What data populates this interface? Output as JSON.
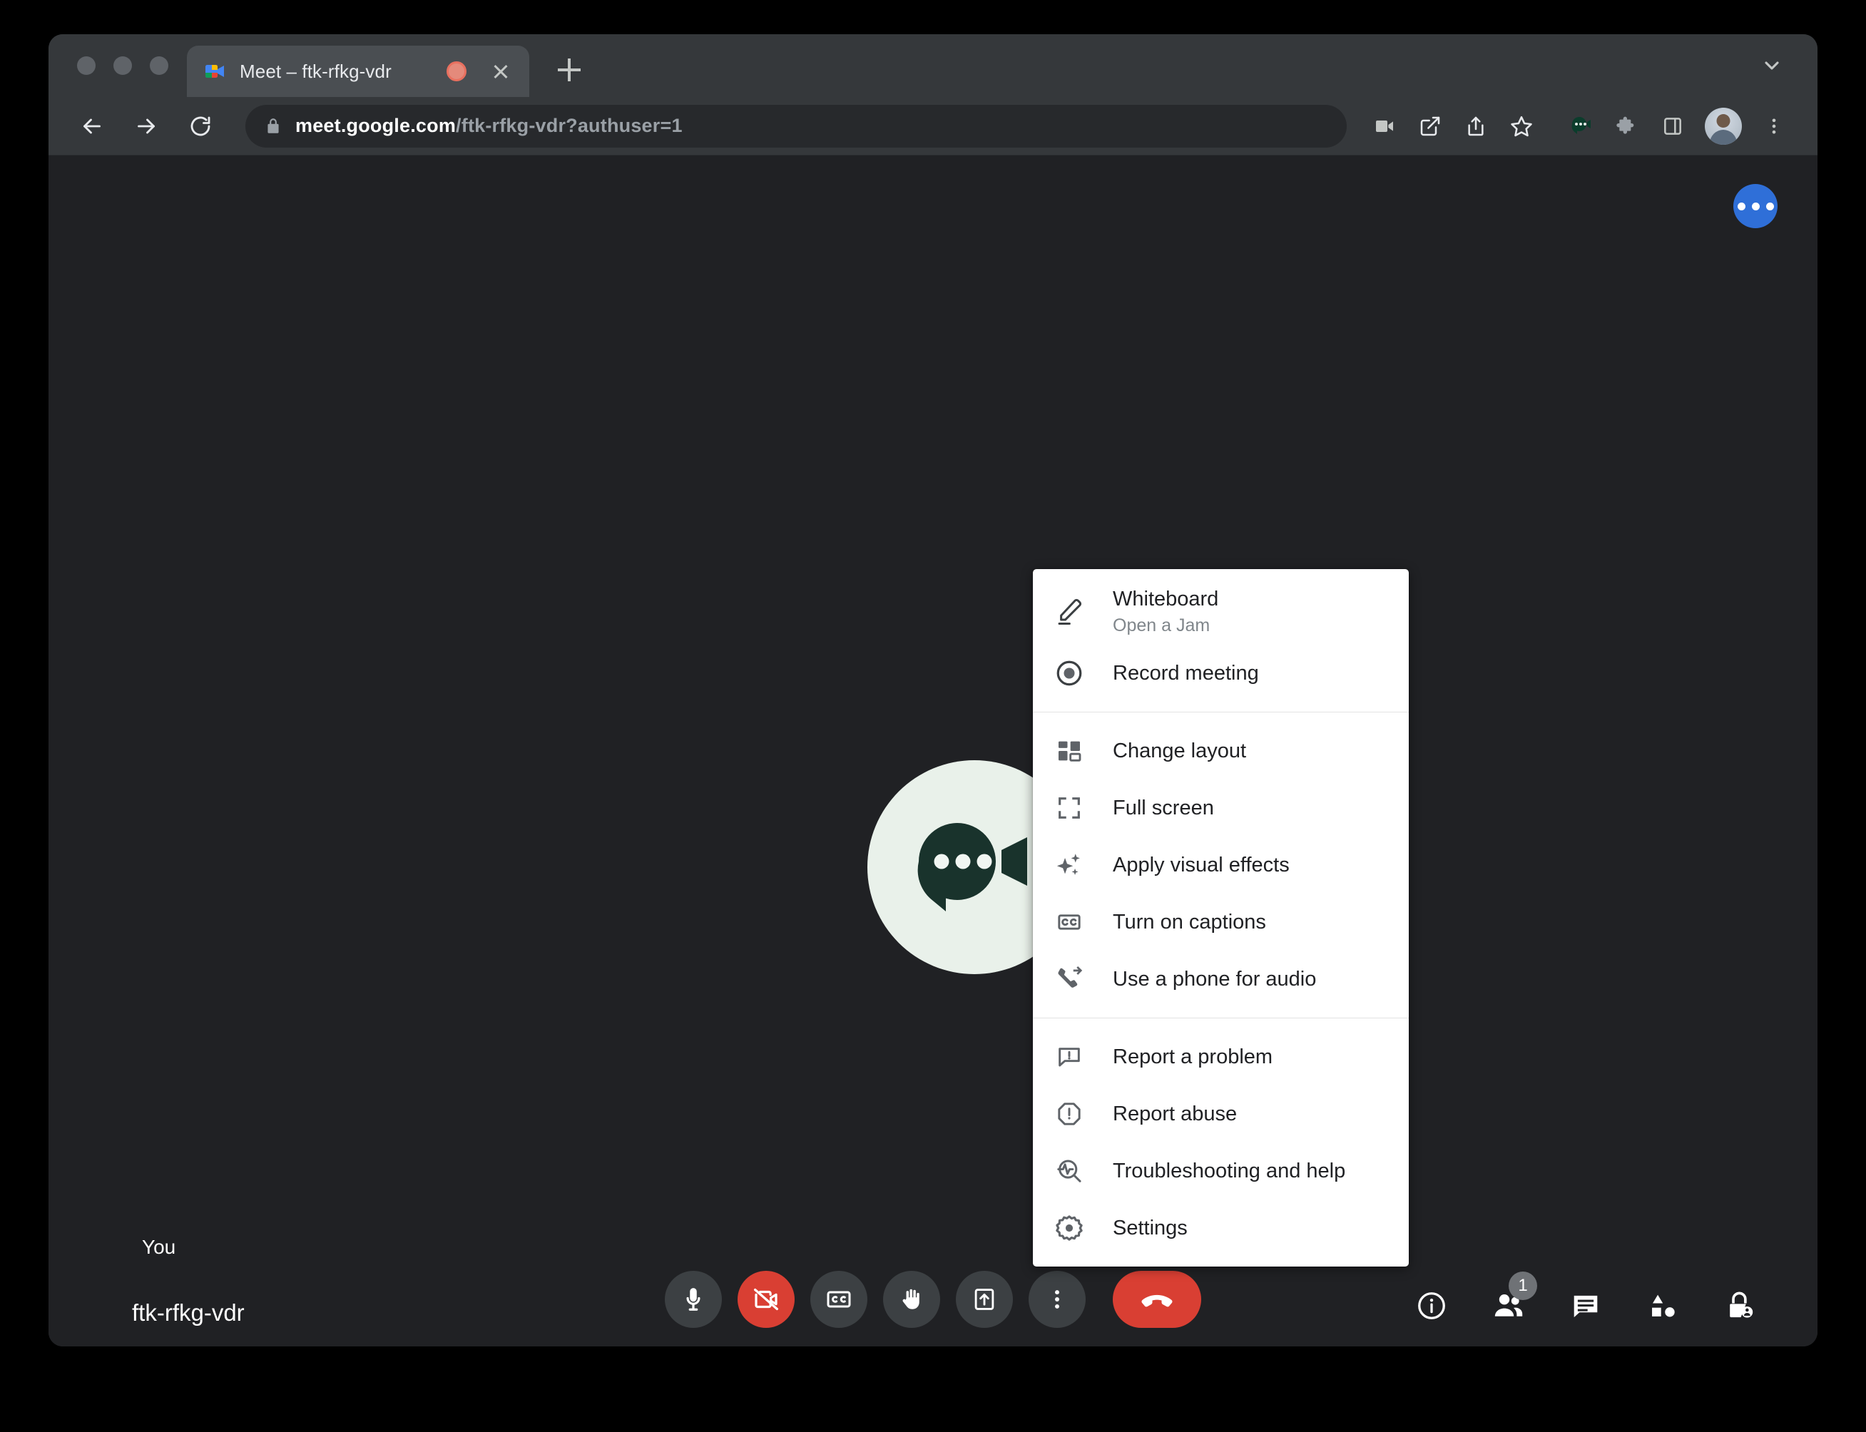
{
  "browser": {
    "tab": {
      "title": "Meet – ftk-rfkg-vdr",
      "favicon_name": "google-meet-favicon",
      "recording_indicator": "tab-recording-indicator",
      "close_label": "×"
    },
    "new_tab_label": "+",
    "tabstrip_chevron": "chevron-down-icon",
    "nav": {
      "back": "back-arrow-icon",
      "forward": "forward-arrow-icon",
      "reload": "reload-icon"
    },
    "omnibox": {
      "lock": "lock-icon",
      "url_domain": "meet.google.com",
      "url_path": "/ftk-rfkg-vdr?authuser=1",
      "full_url": "meet.google.com/ftk-rfkg-vdr?authuser=1"
    },
    "toolbar_icons": [
      "video-camera-icon",
      "open-in-new-icon",
      "share-icon",
      "bookmark-star-icon",
      "meet-extension-icon",
      "extensions-puzzle-icon",
      "side-panel-icon"
    ],
    "profile_avatar": "profile-avatar",
    "menu_icon": "browser-menu-icon"
  },
  "meet": {
    "more_fab": "more-options-fab",
    "stage": {
      "placeholder_avatar": "meet-placeholder-avatar"
    },
    "self_label": "You",
    "meeting_code": "ftk-rfkg-vdr",
    "controls": [
      {
        "name": "microphone-button",
        "icon": "microphone-icon",
        "state": "on",
        "style": "normal"
      },
      {
        "name": "camera-button",
        "icon": "camera-off-icon",
        "state": "off",
        "style": "danger"
      },
      {
        "name": "captions-button",
        "icon": "closed-caption-icon",
        "state": "off",
        "style": "normal"
      },
      {
        "name": "raise-hand-button",
        "icon": "raised-hand-icon",
        "state": "off",
        "style": "normal"
      },
      {
        "name": "present-now-button",
        "icon": "present-screen-icon",
        "state": "off",
        "style": "normal"
      },
      {
        "name": "more-options-button",
        "icon": "more-vertical-icon",
        "state": "open",
        "style": "normal"
      },
      {
        "name": "leave-call-button",
        "icon": "hangup-icon",
        "state": "",
        "style": "hangup"
      }
    ],
    "right_controls": [
      {
        "name": "meeting-details-button",
        "icon": "info-icon",
        "badge": ""
      },
      {
        "name": "participants-button",
        "icon": "people-icon",
        "badge": "1"
      },
      {
        "name": "chat-button",
        "icon": "chat-icon",
        "badge": ""
      },
      {
        "name": "activities-button",
        "icon": "activities-icon",
        "badge": ""
      },
      {
        "name": "host-controls-button",
        "icon": "host-lock-icon",
        "badge": ""
      }
    ]
  },
  "context_menu": {
    "groups": [
      {
        "items": [
          {
            "icon": "whiteboard-pen-icon",
            "label": "Whiteboard",
            "sub": "Open a Jam"
          },
          {
            "icon": "record-circle-icon",
            "label": "Record meeting",
            "sub": ""
          }
        ]
      },
      {
        "items": [
          {
            "icon": "layout-grid-icon",
            "label": "Change layout",
            "sub": ""
          },
          {
            "icon": "fullscreen-icon",
            "label": "Full screen",
            "sub": ""
          },
          {
            "icon": "sparkle-effects-icon",
            "label": "Apply visual effects",
            "sub": ""
          },
          {
            "icon": "closed-caption-icon",
            "label": "Turn on captions",
            "sub": ""
          },
          {
            "icon": "phone-forward-icon",
            "label": "Use a phone for audio",
            "sub": ""
          }
        ]
      },
      {
        "items": [
          {
            "icon": "report-problem-icon",
            "label": "Report a problem",
            "sub": ""
          },
          {
            "icon": "report-abuse-icon",
            "label": "Report abuse",
            "sub": ""
          },
          {
            "icon": "troubleshooting-icon",
            "label": "Troubleshooting and help",
            "sub": ""
          },
          {
            "icon": "settings-gear-icon",
            "label": "Settings",
            "sub": ""
          }
        ]
      }
    ]
  },
  "colors": {
    "page_bg": "#202124",
    "chrome_bg": "#35383b",
    "menu_bg": "#ffffff",
    "danger": "#d93f33",
    "accent_blue": "#2f6fd8",
    "avatar_bg": "#e9f1ea",
    "avatar_fg": "#19332c"
  }
}
